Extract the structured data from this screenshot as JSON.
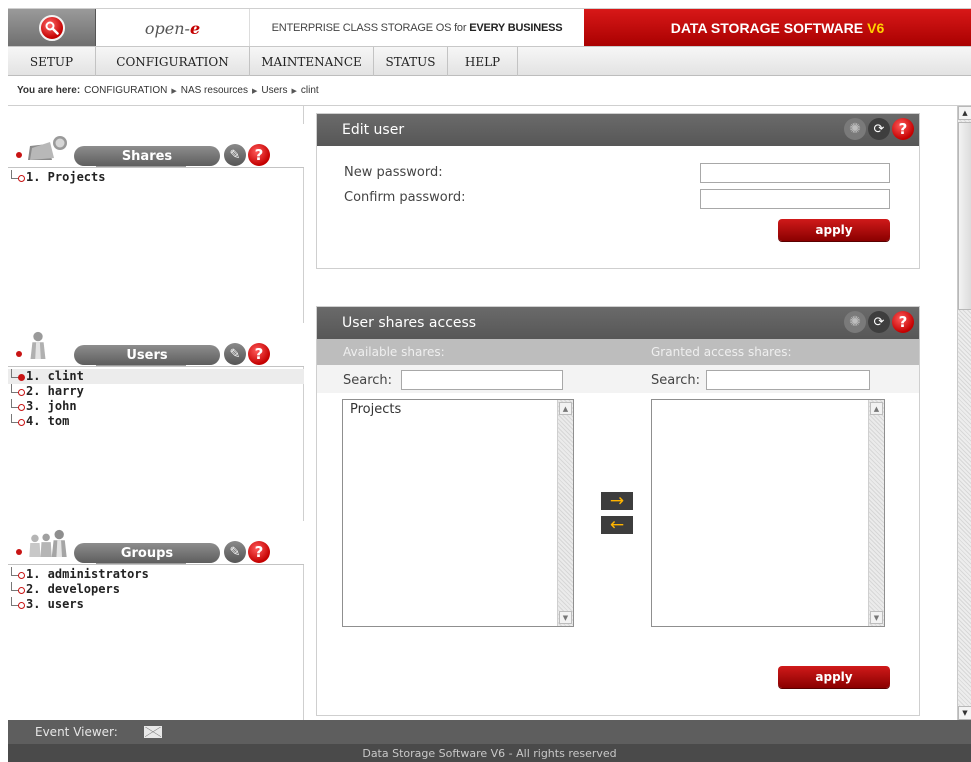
{
  "header": {
    "brand": "open-e",
    "tagline_pre": "ENTERPRISE CLASS STORAGE OS for",
    "tagline_bold": "EVERY BUSINESS",
    "product": "DATA STORAGE SOFTWARE",
    "product_version": "V6",
    "colors": {
      "accent": "#c40000",
      "version": "#ffd200"
    }
  },
  "menu": [
    "SETUP",
    "CONFIGURATION",
    "MAINTENANCE",
    "STATUS",
    "HELP"
  ],
  "breadcrumb": {
    "prefix": "You are here:",
    "items": [
      "CONFIGURATION",
      "NAS resources",
      "Users",
      "clint"
    ]
  },
  "sidebar": {
    "shares": {
      "title": "Shares",
      "items": [
        "1. Projects"
      ]
    },
    "users": {
      "title": "Users",
      "selected": "1. clint",
      "items": [
        "1. clint",
        "2. harry",
        "3. john",
        "4. tom"
      ]
    },
    "groups": {
      "title": "Groups",
      "items": [
        "1. administrators",
        "2. developers",
        "3. users"
      ]
    }
  },
  "edit_user": {
    "title": "Edit user",
    "new_password_label": "New password:",
    "confirm_password_label": "Confirm password:",
    "new_password_value": "",
    "confirm_password_value": "",
    "apply_label": "apply"
  },
  "user_shares_access": {
    "title": "User shares access",
    "available_header": "Available shares:",
    "granted_header": "Granted access shares:",
    "search_label": "Search:",
    "search_available_value": "",
    "search_granted_value": "",
    "available_items": [
      "Projects"
    ],
    "granted_items": [],
    "add_arrow": "→",
    "remove_arrow": "←",
    "apply_label": "apply"
  },
  "footer": {
    "event_viewer_label": "Event Viewer:",
    "copyright": "Data Storage Software V6 - All rights reserved"
  },
  "icons": {
    "logo": "open-e-logo-icon",
    "shares": "shares-folder-icon",
    "users": "user-icon",
    "groups": "group-icon",
    "wrench": "wrench-icon",
    "help": "help-icon",
    "gear": "gear-icon",
    "refresh": "refresh-icon",
    "mail": "mail-icon"
  }
}
